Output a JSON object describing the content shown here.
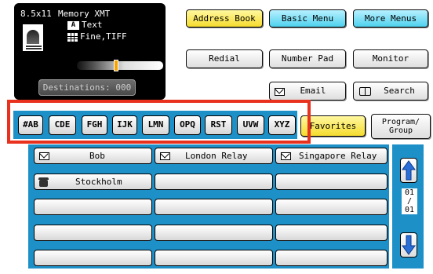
{
  "status": {
    "paper_size": "8.5x11",
    "memory_mode": "Memory XMT",
    "original_type": "Text",
    "original_badge": "A",
    "resolution": "Fine,TIFF",
    "contrast_level": 0.45,
    "destinations_label": "Destinations: 000"
  },
  "top_buttons": {
    "address_book": "Address Book",
    "basic_menu": "Basic Menu",
    "more_menus": "More Menus",
    "redial": "Redial",
    "number_pad": "Number Pad",
    "monitor": "Monitor",
    "email": "Email",
    "search": "Search"
  },
  "tabs": [
    "#AB",
    "CDE",
    "FGH",
    "IJK",
    "LMN",
    "OPQ",
    "RST",
    "UVW",
    "XYZ"
  ],
  "favorites_tab": "Favorites",
  "program_tab": {
    "line1": "Program/",
    "line2": "Group"
  },
  "entries": [
    {
      "label": "Bob",
      "icon": "email-icon"
    },
    {
      "label": "London Relay",
      "icon": "email-icon"
    },
    {
      "label": "Singapore Relay",
      "icon": "email-icon"
    },
    {
      "label": "Stockholm",
      "icon": "fax-icon"
    }
  ],
  "page": {
    "current": "01",
    "sep": "/",
    "total": "01"
  },
  "colors": {
    "highlight": "#e8321e",
    "panel_blue": "#1e90c8",
    "cyan_button": "#4fd2ee",
    "yellow_button": "#f5dc2e"
  }
}
